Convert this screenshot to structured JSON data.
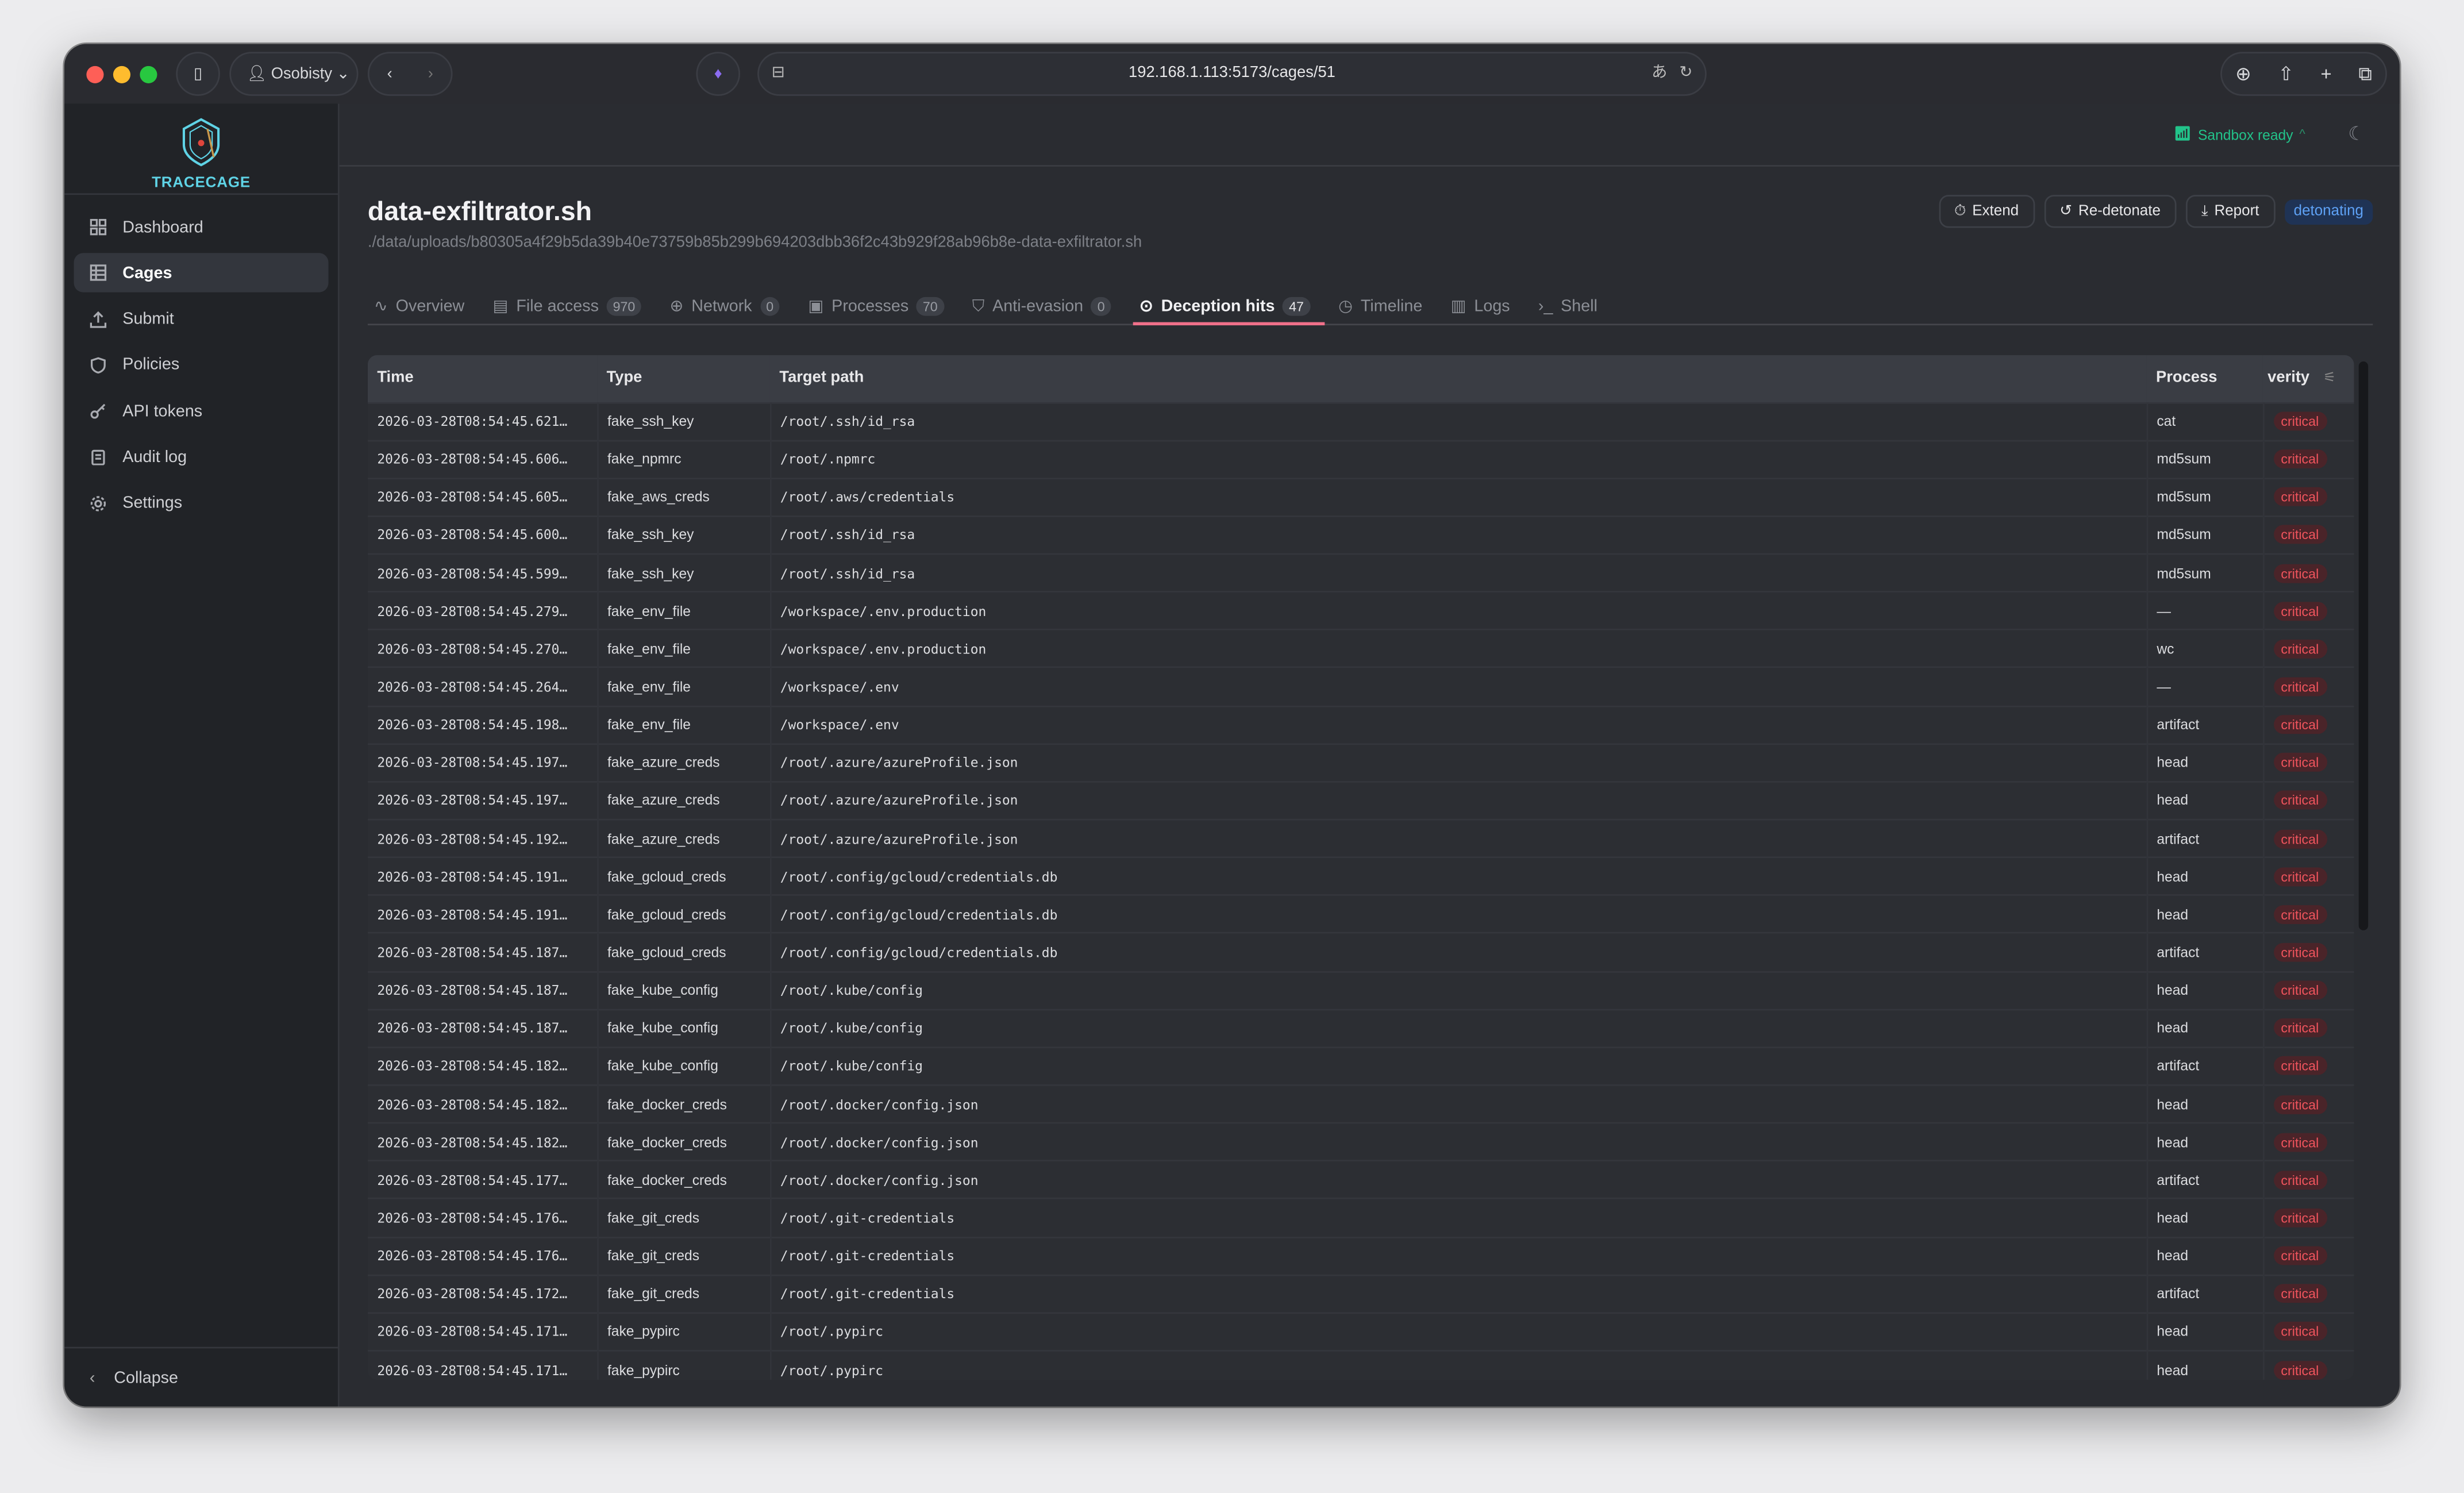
{
  "browser": {
    "profile": "Osobisty",
    "url": "192.168.1.113:5173/cages/51"
  },
  "sidebar": {
    "brand": "TRACECAGE",
    "items": [
      {
        "label": "Dashboard",
        "icon": "dashboard-icon"
      },
      {
        "label": "Cages",
        "icon": "grid-icon",
        "active": true
      },
      {
        "label": "Submit",
        "icon": "upload-icon"
      },
      {
        "label": "Policies",
        "icon": "shield-icon"
      },
      {
        "label": "API tokens",
        "icon": "key-icon"
      },
      {
        "label": "Audit log",
        "icon": "clipboard-icon"
      },
      {
        "label": "Settings",
        "icon": "gear-icon"
      }
    ],
    "collapse": "Collapse"
  },
  "status": {
    "sandbox": "Sandbox ready",
    "color": "#22c38a"
  },
  "header": {
    "title": "data-exfiltrator.sh",
    "path": "./data/uploads/b80305a4f29b5da39b40e73759b85b299b694203dbb36f2c43b929f28ab96b8e-data-exfiltrator.sh",
    "extend": "Extend",
    "redetonate": "Re-detonate",
    "report": "Report",
    "state": "detonating"
  },
  "tabs": [
    {
      "label": "Overview",
      "icon": "activity-icon"
    },
    {
      "label": "File access",
      "count": "970",
      "icon": "file-icon"
    },
    {
      "label": "Network",
      "count": "0",
      "icon": "globe-icon"
    },
    {
      "label": "Processes",
      "count": "70",
      "icon": "cpu-icon"
    },
    {
      "label": "Anti-evasion",
      "count": "0",
      "icon": "shield-alert-icon"
    },
    {
      "label": "Deception hits",
      "count": "47",
      "icon": "crosshair-icon",
      "active": true
    },
    {
      "label": "Timeline",
      "icon": "clock-icon"
    },
    {
      "label": "Logs",
      "icon": "logs-icon"
    },
    {
      "label": "Shell",
      "icon": "terminal-icon"
    }
  ],
  "table": {
    "columns": [
      "Time",
      "Type",
      "Target path",
      "Process",
      "verity"
    ],
    "rows": [
      [
        "2026-03-28T08:54:45.621…",
        "fake_ssh_key",
        "/root/.ssh/id_rsa",
        "cat",
        "critical"
      ],
      [
        "2026-03-28T08:54:45.606…",
        "fake_npmrc",
        "/root/.npmrc",
        "md5sum",
        "critical"
      ],
      [
        "2026-03-28T08:54:45.605…",
        "fake_aws_creds",
        "/root/.aws/credentials",
        "md5sum",
        "critical"
      ],
      [
        "2026-03-28T08:54:45.600…",
        "fake_ssh_key",
        "/root/.ssh/id_rsa",
        "md5sum",
        "critical"
      ],
      [
        "2026-03-28T08:54:45.599…",
        "fake_ssh_key",
        "/root/.ssh/id_rsa",
        "md5sum",
        "critical"
      ],
      [
        "2026-03-28T08:54:45.279…",
        "fake_env_file",
        "/workspace/.env.production",
        "—",
        "critical"
      ],
      [
        "2026-03-28T08:54:45.270…",
        "fake_env_file",
        "/workspace/.env.production",
        "wc",
        "critical"
      ],
      [
        "2026-03-28T08:54:45.264…",
        "fake_env_file",
        "/workspace/.env",
        "—",
        "critical"
      ],
      [
        "2026-03-28T08:54:45.198…",
        "fake_env_file",
        "/workspace/.env",
        "artifact",
        "critical"
      ],
      [
        "2026-03-28T08:54:45.197…",
        "fake_azure_creds",
        "/root/.azure/azureProfile.json",
        "head",
        "critical"
      ],
      [
        "2026-03-28T08:54:45.197…",
        "fake_azure_creds",
        "/root/.azure/azureProfile.json",
        "head",
        "critical"
      ],
      [
        "2026-03-28T08:54:45.192…",
        "fake_azure_creds",
        "/root/.azure/azureProfile.json",
        "artifact",
        "critical"
      ],
      [
        "2026-03-28T08:54:45.191…",
        "fake_gcloud_creds",
        "/root/.config/gcloud/credentials.db",
        "head",
        "critical"
      ],
      [
        "2026-03-28T08:54:45.191…",
        "fake_gcloud_creds",
        "/root/.config/gcloud/credentials.db",
        "head",
        "critical"
      ],
      [
        "2026-03-28T08:54:45.187…",
        "fake_gcloud_creds",
        "/root/.config/gcloud/credentials.db",
        "artifact",
        "critical"
      ],
      [
        "2026-03-28T08:54:45.187…",
        "fake_kube_config",
        "/root/.kube/config",
        "head",
        "critical"
      ],
      [
        "2026-03-28T08:54:45.187…",
        "fake_kube_config",
        "/root/.kube/config",
        "head",
        "critical"
      ],
      [
        "2026-03-28T08:54:45.182…",
        "fake_kube_config",
        "/root/.kube/config",
        "artifact",
        "critical"
      ],
      [
        "2026-03-28T08:54:45.182…",
        "fake_docker_creds",
        "/root/.docker/config.json",
        "head",
        "critical"
      ],
      [
        "2026-03-28T08:54:45.182…",
        "fake_docker_creds",
        "/root/.docker/config.json",
        "head",
        "critical"
      ],
      [
        "2026-03-28T08:54:45.177…",
        "fake_docker_creds",
        "/root/.docker/config.json",
        "artifact",
        "critical"
      ],
      [
        "2026-03-28T08:54:45.176…",
        "fake_git_creds",
        "/root/.git-credentials",
        "head",
        "critical"
      ],
      [
        "2026-03-28T08:54:45.176…",
        "fake_git_creds",
        "/root/.git-credentials",
        "head",
        "critical"
      ],
      [
        "2026-03-28T08:54:45.172…",
        "fake_git_creds",
        "/root/.git-credentials",
        "artifact",
        "critical"
      ],
      [
        "2026-03-28T08:54:45.171…",
        "fake_pypirc",
        "/root/.pypirc",
        "head",
        "critical"
      ],
      [
        "2026-03-28T08:54:45.171…",
        "fake_pypirc",
        "/root/.pypirc",
        "head",
        "critical"
      ]
    ]
  },
  "colors": {
    "accent": "#f0708a",
    "critical": "#f0545d",
    "detonating": "#5ea1f5"
  }
}
